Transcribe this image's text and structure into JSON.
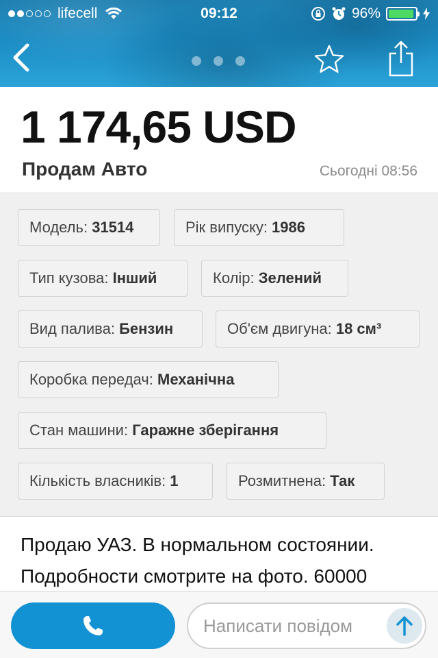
{
  "status_bar": {
    "carrier": "lifecell",
    "time": "09:12",
    "battery": "96%",
    "battery_level": 0.96,
    "battery_color": "#4cd964"
  },
  "header": {
    "back_icon": "chevron-left-icon",
    "gallery_pages": 3,
    "favorite_icon": "star-outline-icon",
    "share_icon": "share-icon",
    "accent": "#1b8cc4"
  },
  "listing": {
    "price": "1 174,65 USD",
    "title": "Продам Авто",
    "date": "Сьогодні 08:56"
  },
  "specs": [
    {
      "label": "Модель: ",
      "value": "31514"
    },
    {
      "label": "Рік випуску: ",
      "value": "1986"
    },
    {
      "label": "Тип кузова: ",
      "value": "Інший"
    },
    {
      "label": "Колір: ",
      "value": "Зелений"
    },
    {
      "label": "Вид палива: ",
      "value": "Бензин"
    },
    {
      "label": "Об'єм двигуна: ",
      "value": "18 см³"
    },
    {
      "label": "Коробка передач: ",
      "value": "Механічна"
    },
    {
      "label": "Стан машини: ",
      "value": "Гаражне зберігання"
    },
    {
      "label": "Кількість власників: ",
      "value": "1"
    },
    {
      "label": "Розмитнена: ",
      "value": "Так"
    }
  ],
  "description": {
    "text": "Продаю УАЗ.  В нормальном состоянии. Подробности смотрите на фото. 60000"
  },
  "bottom_bar": {
    "call_icon": "phone-icon",
    "message_placeholder": "Написати повідом",
    "send_icon": "arrow-up-icon",
    "call_color": "#1392d3"
  }
}
